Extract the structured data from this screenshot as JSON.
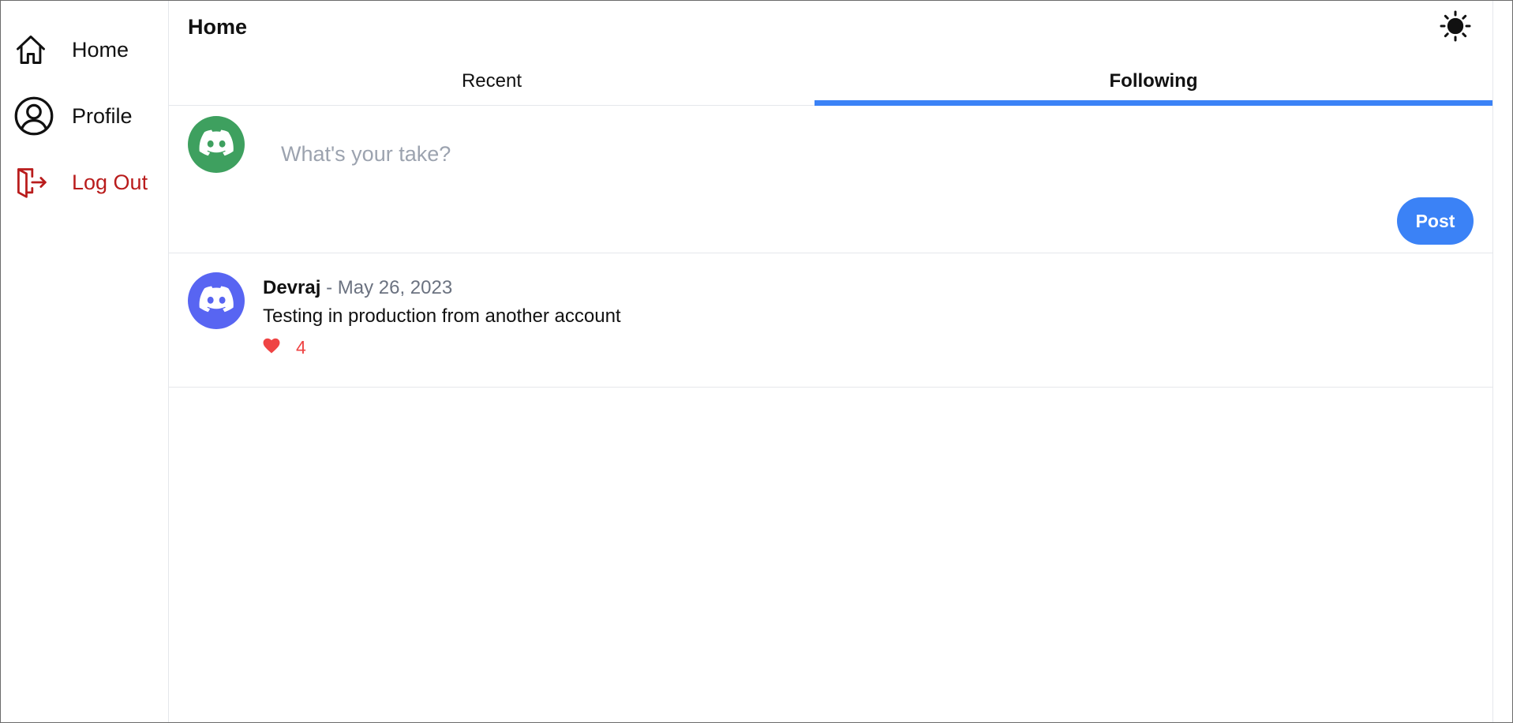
{
  "sidebar": {
    "items": [
      {
        "label": "Home",
        "icon": "home-icon"
      },
      {
        "label": "Profile",
        "icon": "user-circle-icon"
      },
      {
        "label": "Log Out",
        "icon": "logout-icon"
      }
    ]
  },
  "header": {
    "title": "Home",
    "theme_icon": "sun-icon"
  },
  "tabs": [
    {
      "label": "Recent",
      "active": false
    },
    {
      "label": "Following",
      "active": true
    }
  ],
  "composer": {
    "placeholder": "What's your take?",
    "value": "",
    "post_label": "Post",
    "avatar_icon": "discord-icon"
  },
  "posts": [
    {
      "author": "Devraj",
      "separator": "-",
      "date": "May 26, 2023",
      "body": "Testing in production from another account",
      "likes": "4",
      "avatar_icon": "discord-icon"
    }
  ],
  "colors": {
    "accent": "#3b82f6",
    "logout": "#b91c1c",
    "like": "#ef4444",
    "composer_avatar": "#3ea05f",
    "post_avatar": "#5865f2"
  }
}
